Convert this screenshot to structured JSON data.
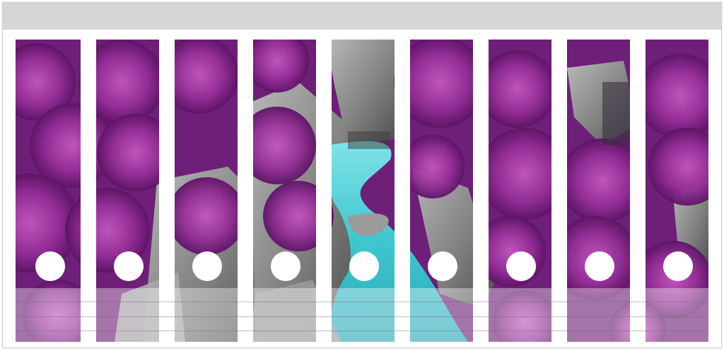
{
  "labels": {
    "count": 9,
    "photo": "purple-forest-turquoise-river",
    "colors": {
      "foliage": "#8a2a8e",
      "foliage_light": "#b347ad",
      "rock": "#8f8f8f",
      "river": "#3fc6cf",
      "top_band": "#d6d6d6"
    }
  }
}
